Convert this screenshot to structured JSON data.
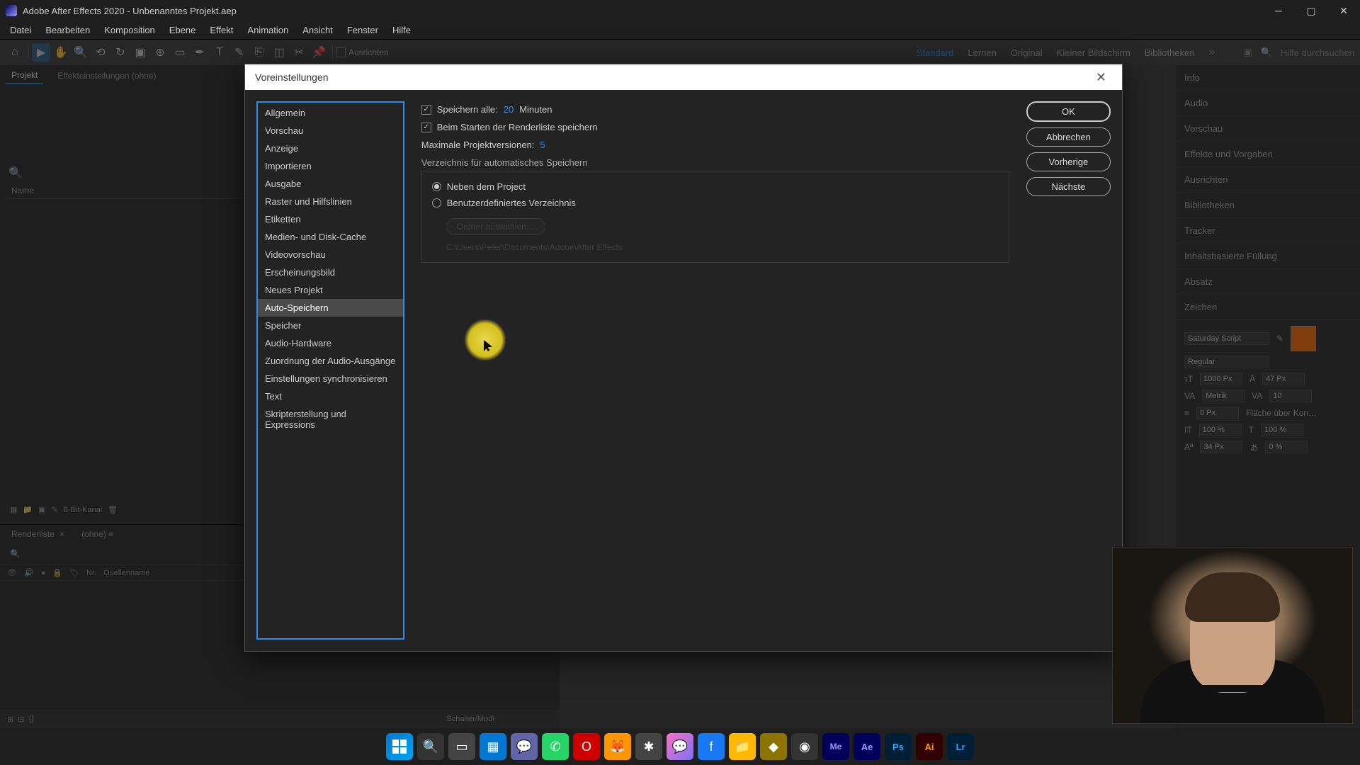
{
  "app": {
    "title": "Adobe After Effects 2020 - Unbenanntes Projekt.aep"
  },
  "menu": [
    "Datei",
    "Bearbeiten",
    "Komposition",
    "Ebene",
    "Effekt",
    "Animation",
    "Ansicht",
    "Fenster",
    "Hilfe"
  ],
  "toolbar": {
    "snap_label": "Ausrichten",
    "search_placeholder": "Hilfe durchsuchen"
  },
  "workspaces": [
    "Standard",
    "Lernen",
    "Original",
    "Kleiner Bildschirm",
    "Bibliotheken"
  ],
  "workspace_active": "Standard",
  "left": {
    "tab_project": "Projekt",
    "tab_effect": "Effekteinstellungen (ohne)",
    "name_col": "Name",
    "bit_depth": "8-Bit-Kanal",
    "renderlist": "Renderliste",
    "ohne": "(ohne)",
    "nr": "Nr.",
    "quellenname": "Quellenname"
  },
  "right_panels": [
    "Info",
    "Audio",
    "Vorschau",
    "Effekte und Vorgaben",
    "Ausrichten",
    "Bibliotheken",
    "Tracker",
    "Inhaltsbasierte Füllung",
    "Absatz",
    "Zeichen"
  ],
  "character": {
    "font": "Saturday Script",
    "style": "Regular",
    "size": "1000 Px",
    "leading": "47 Px",
    "kerning": "Metrik",
    "tracking": "10",
    "baseline": "0 Px",
    "fill_label": "Fläche über Kon…",
    "scale_v": "100 %",
    "scale_h": "100 %",
    "shift": "34 Px",
    "pct": "0 %"
  },
  "dialog": {
    "title": "Voreinstellungen",
    "sidebar": [
      "Allgemein",
      "Vorschau",
      "Anzeige",
      "Importieren",
      "Ausgabe",
      "Raster und Hilfslinien",
      "Etiketten",
      "Medien- und Disk-Cache",
      "Videovorschau",
      "Erscheinungsbild",
      "Neues Projekt",
      "Auto-Speichern",
      "Speicher",
      "Audio-Hardware",
      "Zuordnung der Audio-Ausgänge",
      "Einstellungen synchronisieren",
      "Text",
      "Skripterstellung und Expressions"
    ],
    "sidebar_selected": "Auto-Speichern",
    "save_every_label": "Speichern alle:",
    "save_every_value": "20",
    "save_every_unit": "Minuten",
    "save_on_render": "Beim Starten der Renderliste speichern",
    "max_versions_label": "Maximale Projektversionen:",
    "max_versions_value": "5",
    "folder_group": "Verzeichnis für automatisches Speichern",
    "radio_next": "Neben dem Project",
    "radio_custom": "Benutzerdefiniertes Verzeichnis",
    "choose_folder": "Ordner auswählen…",
    "folder_path": "C:\\Users\\Peter\\Documents\\Adobe\\After Effects",
    "btn_ok": "OK",
    "btn_cancel": "Abbrechen",
    "btn_prev": "Vorherige",
    "btn_next": "Nächste"
  },
  "status": {
    "switches": "Schalter/Modi"
  },
  "colors": {
    "accent": "#2d8ceb",
    "swatch": "#ff6600"
  }
}
